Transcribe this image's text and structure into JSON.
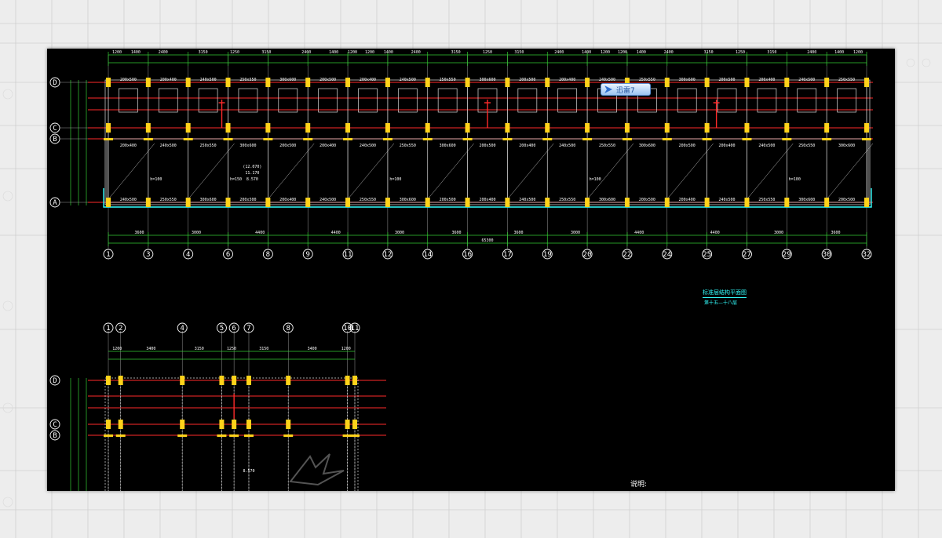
{
  "drawing": {
    "title": "标准层结构平面图",
    "subtitle": "第十五—十八层",
    "notes_label": "说明:",
    "overlay_badge": "迅雷7",
    "total_dimension": "65300"
  },
  "grid": {
    "row_labels": [
      "D",
      "C",
      "B",
      "A"
    ],
    "main_col_labels": [
      "1",
      "3",
      "4",
      "6",
      "8",
      "9",
      "11",
      "12",
      "14",
      "16",
      "17",
      "19",
      "20",
      "22",
      "24",
      "25",
      "27",
      "29",
      "30",
      "32"
    ],
    "bottom_dimensions": [
      "3600",
      "3000",
      "4400",
      "4400",
      "3000",
      "3600",
      "3600",
      "3000",
      "4400",
      "4400",
      "3000",
      "3600"
    ],
    "top_dimensions": [
      "1200",
      "1400",
      "2400",
      "3150",
      "1250",
      "3150",
      "2400",
      "1400",
      "1200"
    ],
    "partial_col_labels": [
      "1",
      "2",
      "4",
      "5",
      "6",
      "7",
      "8",
      "10",
      "11"
    ],
    "partial_top_dimensions": [
      "1200",
      "3400",
      "3150",
      "1250",
      "3150",
      "3400",
      "1200"
    ]
  },
  "annotations": {
    "levels": [
      "(12.070)",
      "11.170",
      "8.570",
      "8.570"
    ],
    "slab_labels": [
      "h=100",
      "h=150",
      "h=100",
      "h=100",
      "h=100"
    ],
    "beam_labels": [
      "200x500",
      "200x400",
      "240x500",
      "250x550",
      "300x600"
    ]
  },
  "colors": {
    "sheet": "#000000",
    "grid_line": "#ff2a2a",
    "axis": "#ffffff",
    "column": "#ffd21a",
    "dimension": "#33cc33",
    "beam": "#dddddd",
    "stair": "#ff2a2a",
    "title_text": "#33ffff",
    "balcony": "#33ffff",
    "beam_label": "#ff66ff"
  }
}
